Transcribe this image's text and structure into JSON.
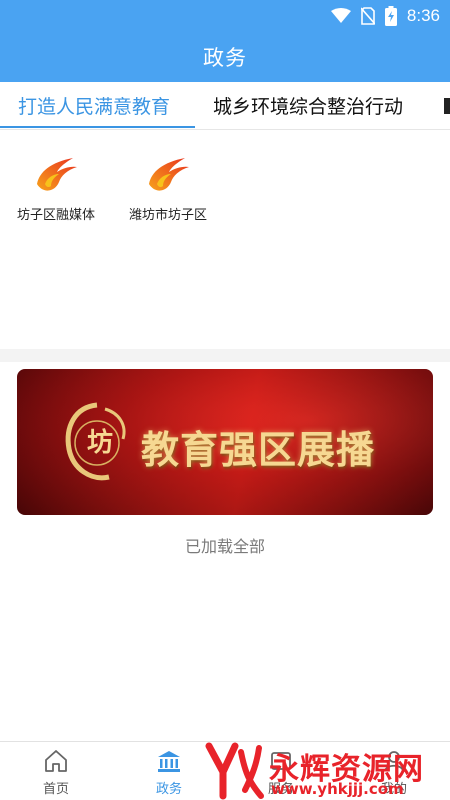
{
  "status_bar": {
    "time": "8:36",
    "icons": [
      "wifi-icon",
      "no-sim-icon",
      "battery-charging-icon"
    ]
  },
  "header": {
    "title": "政务"
  },
  "tabs": [
    {
      "label": "打造人民满意教育",
      "active": true
    },
    {
      "label": "城乡环境综合整治行动",
      "active": false
    },
    {
      "label": "",
      "active": false
    }
  ],
  "sources": [
    {
      "name": "坊子区融媒体",
      "icon": "flame-logo-icon"
    },
    {
      "name": "潍坊市坊子区",
      "icon": "flame-logo-icon"
    }
  ],
  "banner": {
    "title": "教育强区展播"
  },
  "list_footer": {
    "text": "已加载全部"
  },
  "bottom_nav": [
    {
      "label": "首页",
      "icon": "home-icon",
      "active": false
    },
    {
      "label": "政务",
      "icon": "government-building-icon",
      "active": true
    },
    {
      "label": "服务",
      "icon": "service-icon",
      "active": false
    },
    {
      "label": "我的",
      "icon": "profile-icon",
      "active": false
    }
  ],
  "watermark": {
    "text": "永辉资源网",
    "url": "www.yhkjjj.com"
  },
  "colors": {
    "primary": "#4aa3f2",
    "active_tab": "#3b95e3",
    "watermark": "#e8232a"
  }
}
